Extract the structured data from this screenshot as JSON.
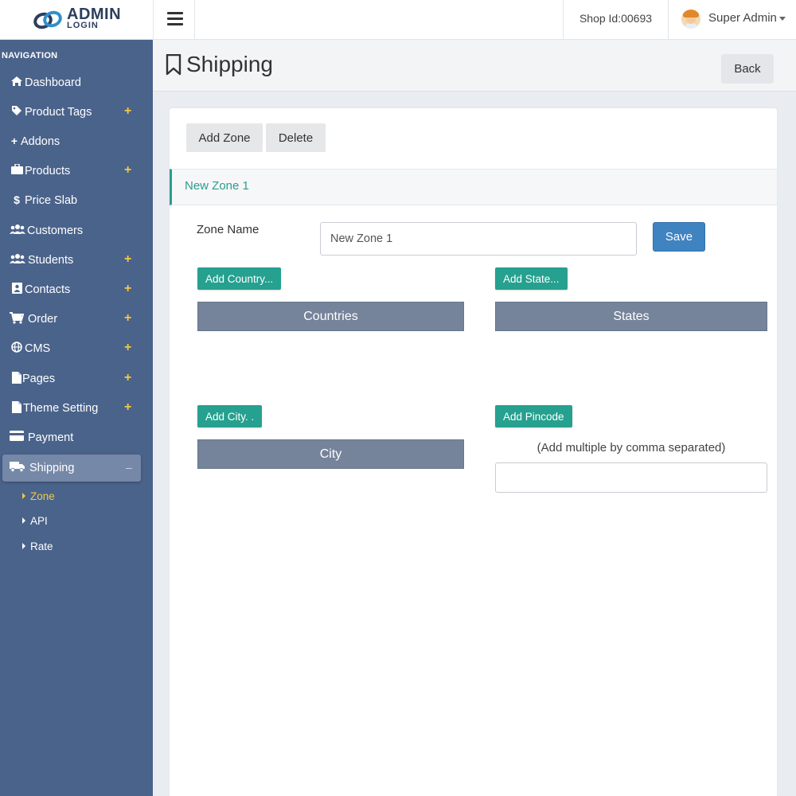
{
  "brand": {
    "title": "ADMIN",
    "subtitle": "LOGIN"
  },
  "topbar": {
    "shop_id": "Shop Id:00693",
    "user_name": "Super Admin"
  },
  "sidebar": {
    "header": "NAVIGATION",
    "items": [
      {
        "label": "Dashboard",
        "icon": "home-icon",
        "expandable": false
      },
      {
        "label": "Product Tags",
        "icon": "tag-icon",
        "expandable": true
      },
      {
        "label": "Addons",
        "icon": "plus-icon",
        "expandable": false
      },
      {
        "label": "Products",
        "icon": "briefcase-icon",
        "expandable": true
      },
      {
        "label": "Price Slab",
        "icon": "dollar-icon",
        "expandable": false
      },
      {
        "label": "Customers",
        "icon": "users-icon",
        "expandable": false
      },
      {
        "label": "Students",
        "icon": "users-icon",
        "expandable": true
      },
      {
        "label": "Contacts",
        "icon": "contact-card-icon",
        "expandable": true
      },
      {
        "label": "Order",
        "icon": "cart-icon",
        "expandable": true
      },
      {
        "label": "CMS",
        "icon": "globe-icon",
        "expandable": true
      },
      {
        "label": "Pages",
        "icon": "file-icon",
        "expandable": true
      },
      {
        "label": "Theme Setting",
        "icon": "file-icon",
        "expandable": true
      },
      {
        "label": "Payment",
        "icon": "credit-card-icon",
        "expandable": false
      },
      {
        "label": "Shipping",
        "icon": "truck-icon",
        "expandable": true,
        "active": true
      }
    ],
    "expand_symbol": "+",
    "collapse_symbol": "–",
    "sub_items": [
      {
        "label": "Zone",
        "active": true
      },
      {
        "label": "API"
      },
      {
        "label": "Rate"
      }
    ]
  },
  "page": {
    "title": "Shipping",
    "back_label": "Back"
  },
  "toolbar": {
    "add_zone": "Add Zone",
    "delete": "Delete"
  },
  "zone_tab": "New Zone 1",
  "form": {
    "zone_name_label": "Zone Name",
    "zone_name_value": "New Zone 1",
    "save_label": "Save",
    "add_country": "Add Country...",
    "add_state": "Add State...",
    "countries_header": "Countries",
    "states_header": "States",
    "add_city": "Add City. .",
    "add_pincode": "Add Pincode",
    "city_header": "City",
    "pincode_hint": "(Add multiple by comma separated)",
    "pincode_value": ""
  },
  "colors": {
    "sidebar": "#4a638b",
    "accent_teal": "#26a08f",
    "primary_blue": "#3f83c0",
    "plus_yellow": "#f2c744"
  }
}
